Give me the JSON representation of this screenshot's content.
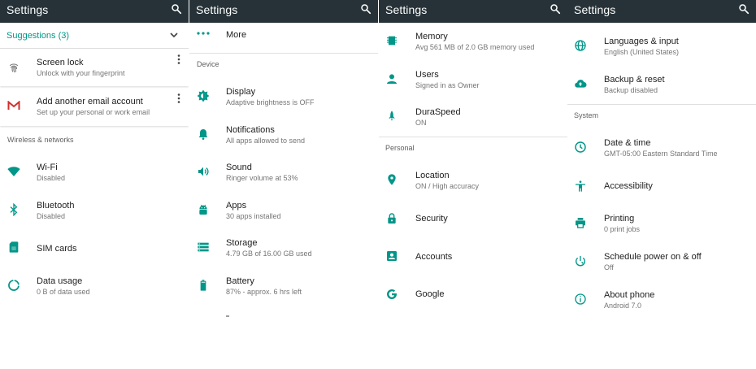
{
  "panels": [
    {
      "title": "Settings",
      "suggestions_label": "Suggestions (3)",
      "suggestions": [
        {
          "title": "Screen lock",
          "subtitle": "Unlock with your fingerprint"
        },
        {
          "title": "Add another email account",
          "subtitle": "Set up your personal or work email"
        }
      ],
      "section": "Wireless & networks",
      "items": [
        {
          "title": "Wi-Fi",
          "subtitle": "Disabled",
          "icon": "wifi-icon"
        },
        {
          "title": "Bluetooth",
          "subtitle": "Disabled",
          "icon": "bluetooth-icon"
        },
        {
          "title": "SIM cards",
          "subtitle": "",
          "icon": "sim-card-icon"
        },
        {
          "title": "Data usage",
          "subtitle": "0 B of data used",
          "icon": "data-usage-icon"
        }
      ]
    },
    {
      "title": "Settings",
      "more_label": "More",
      "section": "Device",
      "items": [
        {
          "title": "Display",
          "subtitle": "Adaptive brightness is OFF",
          "icon": "brightness-icon"
        },
        {
          "title": "Notifications",
          "subtitle": "All apps allowed to send",
          "icon": "bell-icon"
        },
        {
          "title": "Sound",
          "subtitle": "Ringer volume at 53%",
          "icon": "volume-icon"
        },
        {
          "title": "Apps",
          "subtitle": "30 apps installed",
          "icon": "android-icon"
        },
        {
          "title": "Storage",
          "subtitle": "4.79 GB of 16.00 GB used",
          "icon": "storage-icon"
        },
        {
          "title": "Battery",
          "subtitle": "87% - approx. 6 hrs left",
          "icon": "battery-icon"
        }
      ]
    },
    {
      "title": "Settings",
      "items_top": [
        {
          "title": "Memory",
          "subtitle": "Avg 561 MB of 2.0 GB memory used",
          "icon": "memory-icon"
        },
        {
          "title": "Users",
          "subtitle": "Signed in as Owner",
          "icon": "person-icon"
        },
        {
          "title": "DuraSpeed",
          "subtitle": "ON",
          "icon": "rocket-icon"
        }
      ],
      "section": "Personal",
      "items": [
        {
          "title": "Location",
          "subtitle": "ON / High accuracy",
          "icon": "location-pin-icon"
        },
        {
          "title": "Security",
          "subtitle": "",
          "icon": "lock-icon"
        },
        {
          "title": "Accounts",
          "subtitle": "",
          "icon": "account-box-icon"
        },
        {
          "title": "Google",
          "subtitle": "",
          "icon": "google-icon"
        }
      ]
    },
    {
      "title": "Settings",
      "items_top": [
        {
          "title": "Languages & input",
          "subtitle": "English (United States)",
          "icon": "globe-icon"
        },
        {
          "title": "Backup & reset",
          "subtitle": "Backup disabled",
          "icon": "cloud-upload-icon"
        }
      ],
      "section": "System",
      "items": [
        {
          "title": "Date & time",
          "subtitle": "GMT-05:00 Eastern Standard Time",
          "icon": "clock-icon"
        },
        {
          "title": "Accessibility",
          "subtitle": "",
          "icon": "accessibility-icon"
        },
        {
          "title": "Printing",
          "subtitle": "0 print jobs",
          "icon": "printer-icon"
        },
        {
          "title": "Schedule power on & off",
          "subtitle": "Off",
          "icon": "power-schedule-icon"
        },
        {
          "title": "About phone",
          "subtitle": "Android 7.0",
          "icon": "info-icon"
        }
      ]
    }
  ],
  "colors": {
    "appbar": "#263238",
    "accent": "#009688",
    "gmail_red": "#d32f2f",
    "icon_gray": "#757575"
  }
}
